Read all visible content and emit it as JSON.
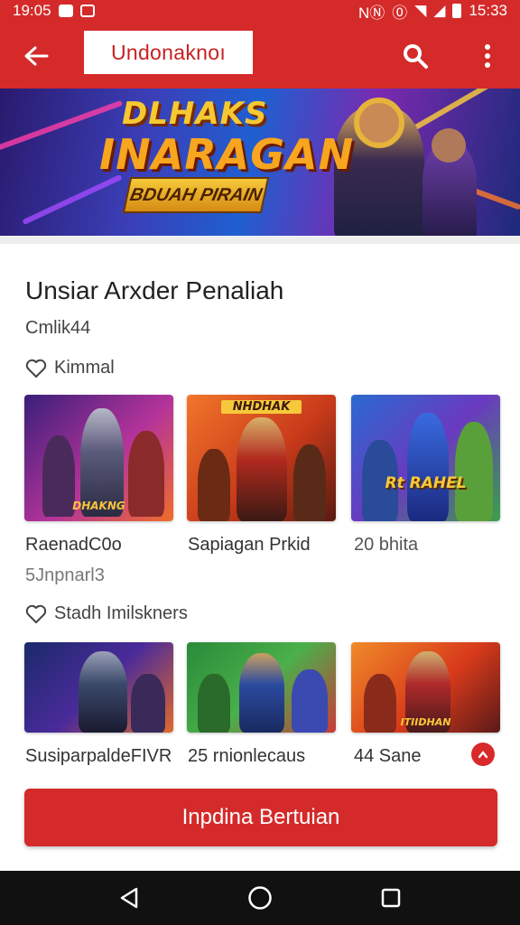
{
  "status_bar": {
    "time_left": "19:05",
    "time_right": "15:33"
  },
  "app_bar": {
    "title": "Undonaknoı",
    "icons": [
      "back-arrow-icon",
      "search-icon",
      "more-vert-icon"
    ]
  },
  "banner": {
    "line1": "DLHAKS",
    "line2": "INARAGAN",
    "plate": "BDUAH PIRAIN"
  },
  "content": {
    "heading": "Unsiar Arxder Penaliah",
    "subheading": "Cmlik44"
  },
  "section1": {
    "label": "Kimmal",
    "cards": [
      {
        "caption": "RaenadC0o",
        "meta": "5Jnpnarl3",
        "art_text": "DHAKNG"
      },
      {
        "caption": "Sapiagan Prkid",
        "art_text": "NHDHAK"
      },
      {
        "caption": "20 bhita",
        "art_text": "Rt RAHEL"
      }
    ]
  },
  "section2": {
    "label": "Stadh Imilskners",
    "cards": [
      {
        "caption": "SusiparpaldeFIVR",
        "art_text": ""
      },
      {
        "caption": "25 rnionlecaus",
        "art_text": ""
      },
      {
        "caption": "44 Sane",
        "art_text": "ITIIDHAN"
      }
    ]
  },
  "cta": {
    "label": "Inpdina Bertuian"
  },
  "colors": {
    "primary": "#d42a2a",
    "navbar": "#111111"
  }
}
